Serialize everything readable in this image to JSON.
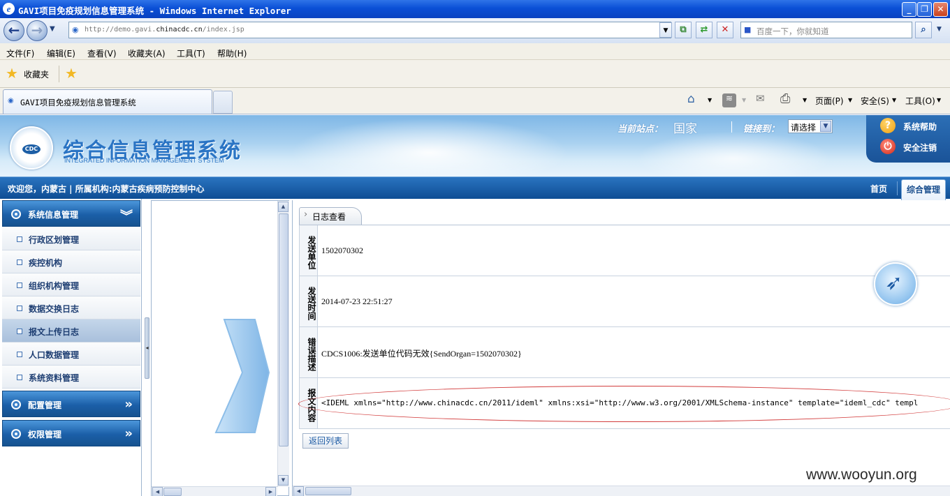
{
  "window": {
    "title": "GAVI项目免疫规划信息管理系统 - Windows Internet Explorer",
    "min": "_",
    "max": "❐",
    "close": "✕"
  },
  "browser": {
    "url_prefix": "http://demo.gavi.",
    "url_domain": "chinacdc.cn",
    "url_suffix": "/index.jsp",
    "search_placeholder": "百度一下，你就知道",
    "menu": [
      "文件(F)",
      "编辑(E)",
      "查看(V)",
      "收藏夹(A)",
      "工具(T)",
      "帮助(H)"
    ],
    "favorites_label": "收藏夹",
    "tab_title": "GAVI项目免疫规划信息管理系统",
    "toolbar": {
      "page": "页面(P)",
      "safety": "安全(S)",
      "tools": "工具(O)"
    }
  },
  "header": {
    "title": "综合信息管理系统",
    "subtitle": "INTEGRATED INFORMATION MANAGEMENT SYSTEM",
    "logo_text": "CDC",
    "current_site_label": "当前站点：",
    "current_site_value": "国家",
    "link_label": "链接到：",
    "link_select": "请选择",
    "help": "系统帮助",
    "logout": "安全注销"
  },
  "nav": {
    "welcome": "欢迎您，内蒙古 | 所属机构:内蒙古疾病预防控制中心",
    "home": "首页",
    "active_tab": "综合管理"
  },
  "sidebar": {
    "groups": [
      {
        "label": "系统信息管理",
        "expanded": true
      },
      {
        "label": "配置管理",
        "expanded": false
      },
      {
        "label": "权限管理",
        "expanded": false
      }
    ],
    "items": [
      "行政区划管理",
      "疾控机构",
      "组织机构管理",
      "数据交换日志",
      "报文上传日志",
      "人口数据管理",
      "系统资料管理"
    ],
    "active_item": "报文上传日志"
  },
  "content": {
    "panel_tab": "日志查看",
    "rows": [
      {
        "label": "发送单位",
        "value": "1502070302"
      },
      {
        "label": "发送时间",
        "value": "2014-07-23 22:51:27"
      },
      {
        "label": "错误描述",
        "value": "CDCS1006:发送单位代码无效{SendOrgan=1502070302}"
      },
      {
        "label": "报文内容",
        "value": "<IDEML xmlns=\"http://www.chinacdc.cn/2011/ideml\" xmlns:xsi=\"http://www.w3.org/2001/XMLSchema-instance\" template=\"ideml_cdc\" templ"
      }
    ],
    "back_button": "返回列表"
  },
  "watermark": "www.wooyun.org",
  "colors": {
    "titlebar": "#0a4fd6",
    "navbar": "#1b5fa8",
    "annotation_red": "#d23b3b"
  }
}
